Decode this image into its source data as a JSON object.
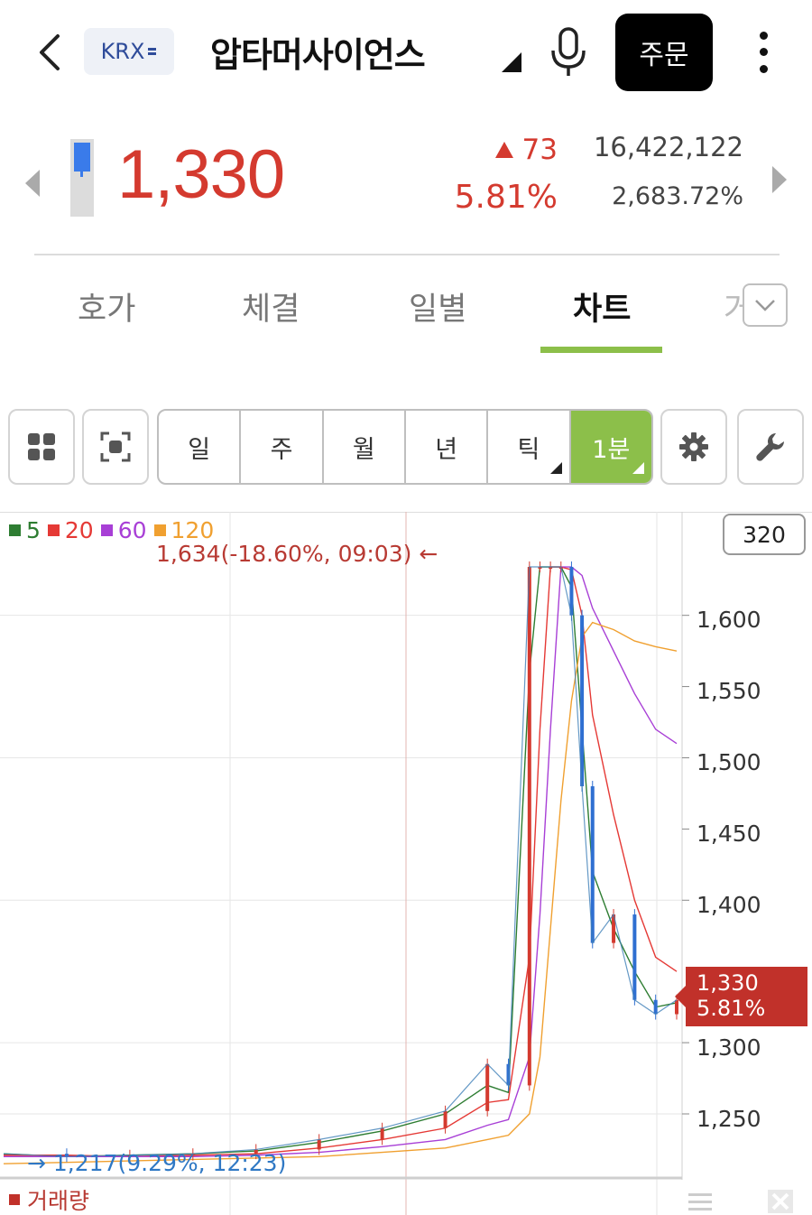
{
  "header": {
    "exchange": "KRX",
    "stock_name": "압타머사이언스",
    "order_label": "주문",
    "icons": [
      "back-arrow-icon",
      "mic-icon",
      "more-vertical-icon"
    ]
  },
  "quote": {
    "price": "1,330",
    "change": "73",
    "change_pct": "5.81%",
    "volume": "16,422,122",
    "turnover_pct": "2,683.72%",
    "up_color": "#d43a2f"
  },
  "tabs": [
    {
      "label": "호가",
      "active": false
    },
    {
      "label": "체결",
      "active": false
    },
    {
      "label": "일별",
      "active": false
    },
    {
      "label": "차트",
      "active": true
    }
  ],
  "tab_partial": "거",
  "toolbar": {
    "periods": [
      {
        "label": "일",
        "active": false,
        "has_menu": false
      },
      {
        "label": "주",
        "active": false,
        "has_menu": false
      },
      {
        "label": "월",
        "active": false,
        "has_menu": false
      },
      {
        "label": "년",
        "active": false,
        "has_menu": false
      },
      {
        "label": "틱",
        "active": false,
        "has_menu": true
      },
      {
        "label": "1분",
        "active": true,
        "has_menu": true
      }
    ],
    "accent": "#8cbf4a"
  },
  "chart_data": {
    "type": "line",
    "legend": [
      {
        "label": "5",
        "color": "#2e7d32"
      },
      {
        "label": "20",
        "color": "#e53935"
      },
      {
        "label": "60",
        "color": "#a83fd6"
      },
      {
        "label": "120",
        "color": "#f0a030"
      }
    ],
    "high_annotation": "1,634(-18.60%, 09:03)",
    "low_annotation": "1,217(9.29%, 12:23)",
    "count": "320",
    "y_ticks": [
      "1,600",
      "1,550",
      "1,500",
      "1,450",
      "1,400",
      "1,300",
      "1,250"
    ],
    "ylim": [
      1205,
      1660
    ],
    "current_price": "1,330",
    "current_pct": "5.81%",
    "x": [
      0,
      30,
      60,
      90,
      120,
      150,
      180,
      210,
      230,
      240,
      250,
      255,
      260,
      265,
      270,
      275,
      280,
      290,
      300,
      310,
      320
    ],
    "price": [
      1222,
      1220,
      1221,
      1222,
      1225,
      1232,
      1240,
      1252,
      1285,
      1270,
      1634,
      1634,
      1634,
      1634,
      1600,
      1480,
      1370,
      1390,
      1330,
      1320,
      1330
    ],
    "series": [
      {
        "name": "5",
        "values": [
          1222,
          1220,
          1221,
          1222,
          1224,
          1230,
          1238,
          1250,
          1270,
          1265,
          1560,
          1634,
          1634,
          1634,
          1620,
          1520,
          1420,
          1380,
          1350,
          1325,
          1328
        ]
      },
      {
        "name": "20",
        "values": [
          1221,
          1221,
          1220,
          1221,
          1222,
          1226,
          1232,
          1240,
          1258,
          1260,
          1360,
          1520,
          1634,
          1634,
          1632,
          1600,
          1530,
          1460,
          1400,
          1360,
          1350
        ]
      },
      {
        "name": "60",
        "values": [
          1220,
          1220,
          1220,
          1220,
          1221,
          1223,
          1227,
          1232,
          1242,
          1246,
          1290,
          1390,
          1520,
          1634,
          1634,
          1628,
          1605,
          1575,
          1545,
          1520,
          1510
        ]
      },
      {
        "name": "120",
        "values": [
          1215,
          1216,
          1217,
          1218,
          1219,
          1220,
          1223,
          1226,
          1232,
          1235,
          1250,
          1290,
          1380,
          1470,
          1540,
          1585,
          1595,
          1590,
          1582,
          1578,
          1575
        ]
      }
    ],
    "volume_label": "거래량"
  }
}
